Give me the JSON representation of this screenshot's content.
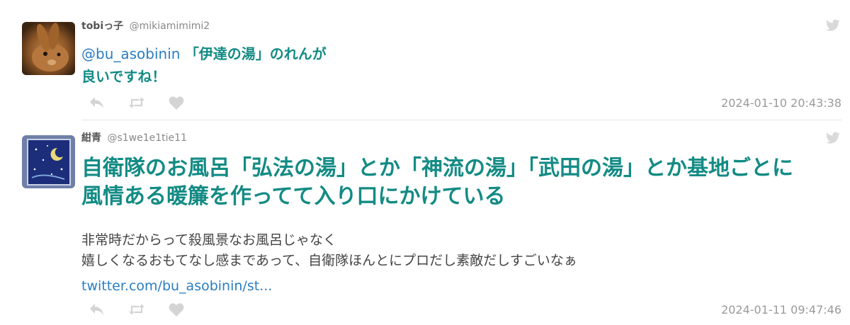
{
  "tweets": [
    {
      "author_name": "tobiっ子",
      "author_handle": "@mikiamimimi2",
      "mention": "@bu_asobinin",
      "text_line1": "「伊達の湯」のれんが",
      "text_line2": "良いですね！",
      "timestamp": "2024-01-10 20:43:38",
      "avatar_icon": "rabbit-photo"
    },
    {
      "author_name": "紺青",
      "author_handle": "@s1we1e1tie11",
      "headline_line1": "自衛隊のお風呂「弘法の湯」とか「神流の湯」「武田の湯」とか基地ごとに",
      "headline_line2": "風情ある暖簾を作ってて入り口にかけている",
      "body_line1": "非常時だからって殺風景なお風呂じゃなく",
      "body_line2": "嬉しくなるおもてなし感まであって、自衛隊ほんとにプロだし素敵だしすごいなぁ",
      "link": "twitter.com/bu_asobinin/st...",
      "timestamp": "2024-01-11 09:47:46",
      "avatar_icon": "night-sky-moon-illustration"
    }
  ],
  "icons": {
    "reply": "reply-icon",
    "retweet": "retweet-icon",
    "like": "heart-icon",
    "brand": "twitter-bird-icon"
  },
  "colors": {
    "accent_teal": "#138b84",
    "link_blue": "#2a7dc4",
    "muted_gray": "#9a9a9a",
    "icon_gray": "#d4d4d4"
  }
}
